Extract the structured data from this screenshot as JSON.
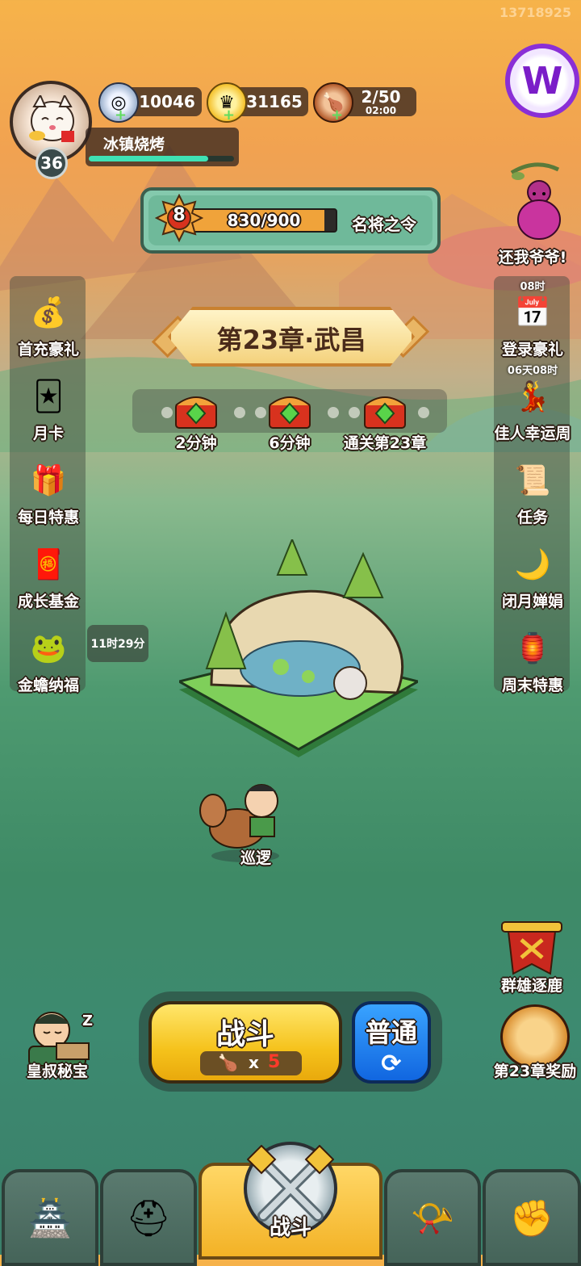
{
  "user_id": "13718925",
  "player": {
    "level": "36",
    "name": "冰镇烧烤",
    "exp_fraction": 0.82
  },
  "resources": [
    {
      "name": "silver-coin",
      "value": "10046"
    },
    {
      "name": "gold-ingot",
      "value": "31165"
    },
    {
      "name": "meat-stamina",
      "value": "2/50",
      "timer": "02:00"
    }
  ],
  "order": {
    "level": "8",
    "progress": "830/900",
    "fraction": 0.922,
    "title": "名将之令"
  },
  "top_right_event": {
    "label": "还我爷爷!"
  },
  "left_menu": [
    {
      "label": "首充豪礼",
      "icon": "treasure-chest-icon"
    },
    {
      "label": "月卡",
      "icon": "card-icon"
    },
    {
      "label": "每日特惠",
      "icon": "gift-bag-icon"
    },
    {
      "label": "成长基金",
      "icon": "fortune-god-icon"
    },
    {
      "label": "金蟾纳福",
      "icon": "golden-toad-icon",
      "timer": "11时29分"
    }
  ],
  "right_menu": [
    {
      "label": "登录豪礼",
      "icon": "calendar-icon",
      "tag": "08时"
    },
    {
      "label": "佳人幸运周",
      "icon": "beauty-icon",
      "tag": "06天08时"
    },
    {
      "label": "任务",
      "icon": "task-scroll-icon"
    },
    {
      "label": "闭月婵娟",
      "icon": "moon-fairy-icon"
    },
    {
      "label": "周末特惠",
      "icon": "weekend-sale-icon"
    }
  ],
  "chapter": {
    "title": "第23章·武昌"
  },
  "chests": [
    {
      "label": "2分钟"
    },
    {
      "label": "6分钟"
    },
    {
      "label": "通关第23章"
    }
  ],
  "patrol": {
    "label": "巡逻"
  },
  "right_bottom": [
    {
      "label": "群雄逐鹿",
      "icon": "banner-war-icon"
    },
    {
      "label": "第23章奖励",
      "icon": "chapter-reward-icon"
    }
  ],
  "left_bottom": {
    "label": "皇叔秘宝",
    "icon": "sleeping-uncle-icon",
    "zz": "Z"
  },
  "fight": {
    "label": "战斗",
    "cost_x": "x",
    "cost": "5"
  },
  "mode": {
    "label": "普通",
    "refresh": "⟳"
  },
  "nav": {
    "center_label": "战斗"
  }
}
